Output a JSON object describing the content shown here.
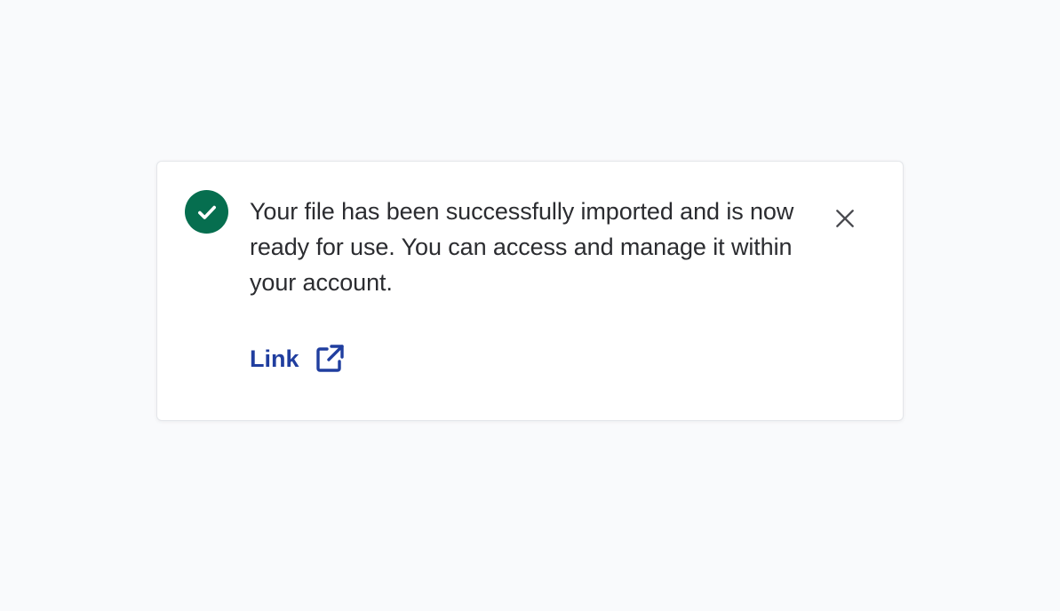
{
  "notification": {
    "type": "success",
    "message": "Your file has been successfully imported and is now ready for use. You can access and manage it within your account.",
    "link_label": "Link",
    "icons": {
      "status": "check-circle-icon",
      "close": "close-icon",
      "link": "external-link-icon"
    },
    "colors": {
      "success": "#066e4f",
      "link": "#203e9f",
      "text": "#2b2c30",
      "close": "#4a4b50",
      "background": "#f9fafc",
      "card": "#ffffff"
    }
  }
}
